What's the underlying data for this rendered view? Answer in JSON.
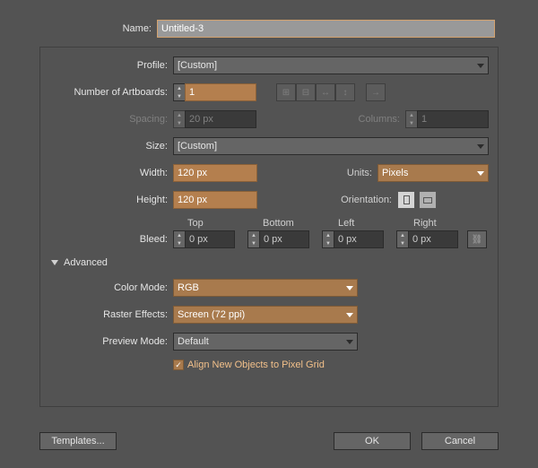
{
  "labels": {
    "name": "Name:",
    "profile": "Profile:",
    "artboards": "Number of Artboards:",
    "spacing": "Spacing:",
    "columns": "Columns:",
    "size": "Size:",
    "width": "Width:",
    "height": "Height:",
    "units": "Units:",
    "orientation": "Orientation:",
    "bleed": "Bleed:",
    "top": "Top",
    "bottom": "Bottom",
    "left": "Left",
    "right": "Right",
    "advanced": "Advanced",
    "colormode": "Color Mode:",
    "raster": "Raster Effects:",
    "preview": "Preview Mode:",
    "align": "Align New Objects to Pixel Grid"
  },
  "values": {
    "name": "Untitled-3",
    "profile": "[Custom]",
    "artboards": "1",
    "spacing": "20 px",
    "columns": "1",
    "size": "[Custom]",
    "width": "120 px",
    "height": "120 px",
    "units": "Pixels",
    "top": "0 px",
    "bottom": "0 px",
    "left": "0 px",
    "right": "0 px",
    "colormode": "RGB",
    "raster": "Screen (72 ppi)",
    "preview": "Default"
  },
  "buttons": {
    "templates": "Templates...",
    "ok": "OK",
    "cancel": "Cancel"
  }
}
